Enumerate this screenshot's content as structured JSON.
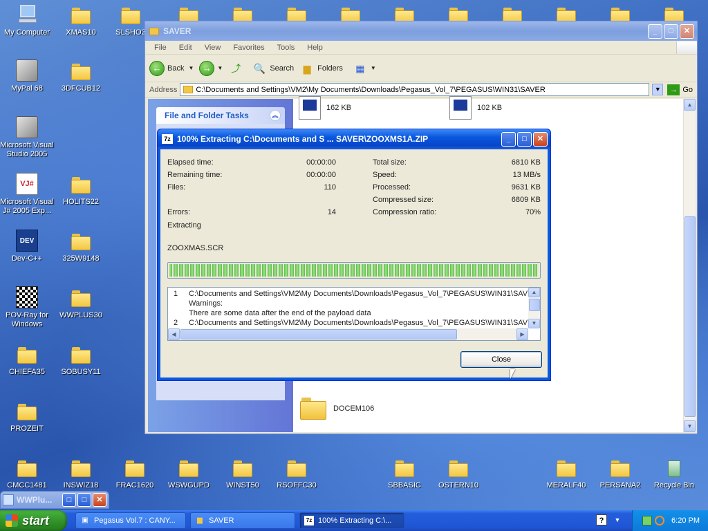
{
  "desktop": {
    "icons": [
      {
        "label": "My Computer"
      },
      {
        "label": "XMAS10"
      },
      {
        "label": "SLSHO3"
      },
      {
        "label": "MyPal 68"
      },
      {
        "label": "3DFCUB12"
      },
      {
        "label": "Microsoft Visual Studio 2005"
      },
      {
        "label": "Microsoft Visual J# 2005 Exp..."
      },
      {
        "label": "HOLITS22"
      },
      {
        "label": "Dev-C++"
      },
      {
        "label": "325W9148"
      },
      {
        "label": "POV-Ray for Windows"
      },
      {
        "label": "WWPLUS30"
      },
      {
        "label": "CHIEFA35"
      },
      {
        "label": "SOBUSY11"
      },
      {
        "label": "PROZEIT"
      },
      {
        "label": "CMCC1481"
      },
      {
        "label": "INSWIZ18"
      },
      {
        "label": "FRAC1620"
      },
      {
        "label": "WSWGUPD"
      },
      {
        "label": "WINST50"
      },
      {
        "label": "RSOFFC30"
      },
      {
        "label": "SBBASIC"
      },
      {
        "label": "OSTERN10"
      },
      {
        "label": "MERALF40"
      },
      {
        "label": "PERSANA2"
      },
      {
        "label": "Recycle Bin"
      }
    ]
  },
  "explorer": {
    "title": "SAVER",
    "menu": [
      "File",
      "Edit",
      "View",
      "Favorites",
      "Tools",
      "Help"
    ],
    "toolbar": {
      "back": "Back",
      "search": "Search",
      "folders": "Folders"
    },
    "address_label": "Address",
    "address_value": "C:\\Documents and Settings\\VM2\\My Documents\\Downloads\\Pegasus_Vol_7\\PEGASUS\\WIN31\\SAVER",
    "go_label": "Go",
    "tasks_header": "File and Folder Tasks",
    "files": [
      {
        "size": "162 KB"
      },
      {
        "size": "102 KB"
      },
      {
        "name": "DOCEM106"
      }
    ]
  },
  "dialog": {
    "title": "100% Extracting C:\\Documents and S ... SAVER\\ZOOXMS1A.ZIP",
    "left_stats": [
      {
        "label": "Elapsed time:",
        "value": "00:00:00"
      },
      {
        "label": "Remaining time:",
        "value": "00:00:00"
      },
      {
        "label": "Files:",
        "value": "110"
      },
      {
        "label": "Errors:",
        "value": "14"
      }
    ],
    "right_stats": [
      {
        "label": "Total size:",
        "value": "6810 KB"
      },
      {
        "label": "Speed:",
        "value": "13 MB/s"
      },
      {
        "label": "Processed:",
        "value": "9631 KB"
      },
      {
        "label": "Compressed size:",
        "value": "6809 KB"
      },
      {
        "label": "Compression ratio:",
        "value": "70%"
      }
    ],
    "status": "Extracting",
    "current_file": "ZOOXMAS.SCR",
    "progress_percent": 100,
    "log": [
      {
        "num": "1",
        "text": "C:\\Documents and Settings\\VM2\\My Documents\\Downloads\\Pegasus_Vol_7\\PEGASUS\\WIN31\\SAVER"
      },
      {
        "num": "",
        "text": "Warnings:"
      },
      {
        "num": "",
        "text": "There are some data after the end of the payload data"
      },
      {
        "num": "2",
        "text": "C:\\Documents and Settings\\VM2\\My Documents\\Downloads\\Pegasus_Vol_7\\PEGASUS\\WIN31\\SAVER"
      }
    ],
    "close_label": "Close"
  },
  "mini_window": {
    "title": "WWPlu..."
  },
  "taskbar": {
    "start_label": "start",
    "tasks": [
      {
        "label": "Pegasus Vol.7 : CANY..."
      },
      {
        "label": "SAVER"
      },
      {
        "label": "100% Extracting C:\\..."
      }
    ],
    "clock": "6:20 PM"
  }
}
